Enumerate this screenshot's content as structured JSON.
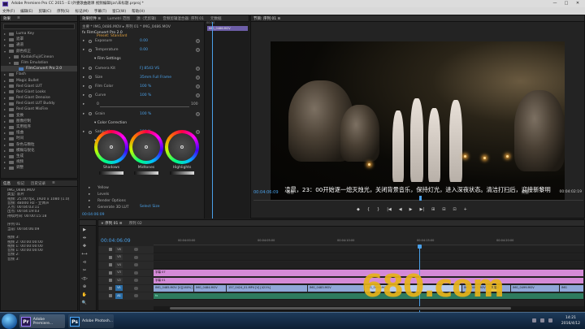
{
  "window": {
    "title": "Adobe Premiere Pro CC 2015 - E:\\外婆歌曲磨课 视频编辑\\jzc\\未标题.prproj *",
    "min": "—",
    "max": "□",
    "close": "✕"
  },
  "menu": [
    "文件(F)",
    "编辑(E)",
    "剪辑(C)",
    "序列(S)",
    "标记(M)",
    "字幕(T)",
    "窗口(W)",
    "帮助(H)"
  ],
  "effects_panel": {
    "tabs": [
      "效果",
      "≡"
    ],
    "items": [
      {
        "label": "Luma Key",
        "type": "folder",
        "expanded": false,
        "indent": 0
      },
      {
        "label": "遮罩",
        "type": "folder",
        "expanded": false,
        "indent": 0
      },
      {
        "label": "通道",
        "type": "folder",
        "expanded": false,
        "indent": 0
      },
      {
        "label": "颜色校正",
        "type": "folder",
        "expanded": true,
        "indent": 0
      },
      {
        "label": "Kodak/Fuji/Cineon",
        "type": "folder",
        "expanded": false,
        "indent": 1
      },
      {
        "label": "Film Emulation",
        "type": "folder",
        "expanded": true,
        "indent": 1
      },
      {
        "label": "FilmConvert Pro 2.0",
        "type": "item",
        "selected": true,
        "indent": 2
      },
      {
        "label": "Flash",
        "type": "folder",
        "expanded": false,
        "indent": 0
      },
      {
        "label": "Magic Bullet",
        "type": "folder",
        "expanded": false,
        "indent": 0
      },
      {
        "label": "Red Giant LUT",
        "type": "folder",
        "expanded": false,
        "indent": 0
      },
      {
        "label": "Red Giant Looks",
        "type": "folder",
        "expanded": false,
        "indent": 0
      },
      {
        "label": "Red Giant Denoise",
        "type": "folder",
        "expanded": false,
        "indent": 0
      },
      {
        "label": "Red Giant LUT Buddy",
        "type": "folder",
        "expanded": false,
        "indent": 0
      },
      {
        "label": "Red Giant MisFire",
        "type": "folder",
        "expanded": false,
        "indent": 0
      },
      {
        "label": "变换",
        "type": "folder",
        "expanded": false,
        "indent": 0
      },
      {
        "label": "图像控制",
        "type": "folder",
        "expanded": false,
        "indent": 0
      },
      {
        "label": "实用程序",
        "type": "folder",
        "expanded": false,
        "indent": 0
      },
      {
        "label": "扭曲",
        "type": "folder",
        "expanded": false,
        "indent": 0
      },
      {
        "label": "时间",
        "type": "folder",
        "expanded": false,
        "indent": 0
      },
      {
        "label": "杂色与颗粒",
        "type": "folder",
        "expanded": false,
        "indent": 0
      },
      {
        "label": "模糊与锐化",
        "type": "folder",
        "expanded": false,
        "indent": 0
      },
      {
        "label": "生成",
        "type": "folder",
        "expanded": false,
        "indent": 0
      },
      {
        "label": "视频",
        "type": "folder",
        "expanded": false,
        "indent": 0
      },
      {
        "label": "调整",
        "type": "folder",
        "expanded": false,
        "indent": 0
      }
    ]
  },
  "info_panel": {
    "tabs": [
      "信息",
      "标记",
      "历史记录",
      "≡"
    ],
    "lines": [
      "IMG_0486.MOV",
      "类型: 影片",
      "视频: 25.00 fps, 1920 x 1080 (1.0)",
      "音频: 48000 Hz - 立体声",
      "入点: 00:04:03:11",
      "出点: 00:04:19:03",
      "持续时间: 00:00:15:18",
      "",
      "序列 01",
      "当前: 00:04:06:09",
      "",
      "视频 3:",
      "视频 2: 00:00:00:00",
      "视频 1: 00:00:00:00",
      "音频 1: 00:00:00:00",
      "音频 2:",
      "音频 3:"
    ]
  },
  "effect_controls": {
    "tabs": [
      "效果控件 ≡",
      "Lumetri 范围",
      "源: (无剪辑)",
      "音频剪辑混合器: 序列 01",
      "元数据"
    ],
    "breadcrumb": "主要 * IMG_0486.MOV ▸ 序列 01 * IMG_0486.MOV",
    "fx_title": "fx  FilmConvert Pro 2.0",
    "preset": "Preset: Standard",
    "rows": [
      {
        "label": "Exposure",
        "value": "0.00"
      },
      {
        "label": "Temperature",
        "value": "0.00"
      },
      {
        "header": "Film Settings"
      },
      {
        "label": "Camera Kit",
        "value": "FJ 8543 VS"
      },
      {
        "label": "Size",
        "value": "35mm Full Frame"
      },
      {
        "label": "Film Color",
        "value": "100 %"
      },
      {
        "label": "Curve",
        "value": "100 %"
      },
      {
        "label": "",
        "value": "0",
        "endval": "100"
      },
      {
        "label": "Grain",
        "value": "100 %"
      },
      {
        "header": "Color Correction"
      },
      {
        "label": "Saturation",
        "value": "100 %"
      },
      {
        "header": "Color Wheels"
      }
    ],
    "wheels": [
      "Shadows",
      "Midtones",
      "Highlights"
    ],
    "rows_bottom": [
      "Yellow",
      "Levels",
      "Render Options",
      "Generate 3D LUT"
    ],
    "lut_value": "Select Size",
    "footer_tc": "00:04:06:09",
    "mini_clip": "IMG_0486.MOV",
    "mini_tc": "00:04"
  },
  "program": {
    "tabs": [
      "节目: 序列 01 ≡"
    ],
    "subtitle": "凌晨，23：00开始逐一熄灭烛光，关闭背景音乐，保持灯光，进入深夜状态。清洁打扫后，迎接新黎明",
    "timecode": "00:04:06:09",
    "fit": "适合",
    "full": "完整",
    "duration": "00:04:02:19",
    "controls": [
      "◆",
      "{",
      "}",
      "|◀",
      "◀",
      "▶",
      "▶|",
      "⊞",
      "⊟",
      "⊡",
      "+"
    ]
  },
  "tools": [
    "▶",
    "⇹",
    "✥",
    "⟷",
    "⊲",
    "✂",
    "◁▷",
    "⊕",
    "✋",
    "🔍"
  ],
  "timeline": {
    "tabs": [
      "× 序列 01 ≡",
      "序列 02"
    ],
    "timecode": "00:04:06:09",
    "ruler": [
      "00:04:00:00",
      "00:04:05:00",
      "00:04:10:00",
      "00:04:15:00",
      "00:04:20:00"
    ],
    "tracks": [
      {
        "name": "V6",
        "kind": "video"
      },
      {
        "name": "V5",
        "kind": "video"
      },
      {
        "name": "V4",
        "kind": "video"
      },
      {
        "name": "V3",
        "kind": "video",
        "clips": [
          {
            "label": "字幕 07",
            "type": "title",
            "start": 0,
            "end": 530
          }
        ]
      },
      {
        "name": "V2",
        "kind": "video",
        "clips": [
          {
            "label": "字幕 01",
            "type": "title",
            "start": 0,
            "end": 530
          }
        ]
      },
      {
        "name": "V1",
        "kind": "video",
        "target": true,
        "clips": [
          {
            "label": "IMG_0485.MOV [V][160%]",
            "type": "video",
            "start": 0,
            "end": 50,
            "fx": "交叉溶解"
          },
          {
            "label": "IMG_0484.MOV",
            "type": "video",
            "start": 50,
            "end": 90
          },
          {
            "label": "157_0424_01.MP4 [V] [421%]",
            "type": "video",
            "start": 90,
            "end": 190
          },
          {
            "label": "IMG_0483.MOV",
            "type": "video",
            "start": 190,
            "end": 260
          },
          {
            "label": "IMG_0486.MOV",
            "type": "video",
            "start": 260,
            "end": 380,
            "selected": true
          },
          {
            "label": "IMG_0491.MOV",
            "type": "video",
            "start": 380,
            "end": 440,
            "fx": "交叉溶解"
          },
          {
            "label": "IMG_0499.MOV",
            "type": "video",
            "start": 440,
            "end": 500
          },
          {
            "label": "IMG",
            "type": "video",
            "start": 500,
            "end": 530
          }
        ]
      },
      {
        "name": "A1",
        "kind": "audio",
        "target": true,
        "clips": [
          {
            "label": "fx",
            "type": "audio",
            "start": 0,
            "end": 530
          }
        ]
      }
    ]
  },
  "watermark": "680.com",
  "taskbar": {
    "items": [
      {
        "label": "Adobe Premiere...",
        "icon": "Pr",
        "color": "#2a1a52"
      },
      {
        "label": "Adobe Photosh...",
        "icon": "Ps",
        "color": "#0a2a4a"
      }
    ],
    "time": "14:21",
    "date": "2016/4/12"
  }
}
